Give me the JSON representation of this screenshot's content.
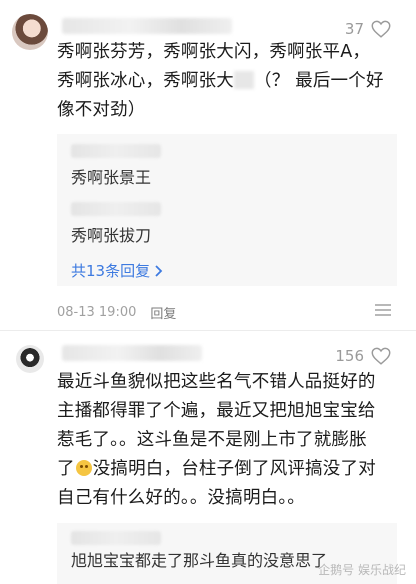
{
  "comments": [
    {
      "likes": "37",
      "text_lines": [
        "秀啊张芬芳，秀啊张大闪，秀啊张平A，",
        "秀啊张冰心，秀啊张大",
        "（？ 最后一个好",
        "像不对劲）"
      ],
      "replies": [
        {
          "text": "秀啊张景王"
        },
        {
          "text": "秀啊张拔刀"
        }
      ],
      "more_replies": "共13条回复",
      "time": "08-13 19:00",
      "reply_label": "回复"
    },
    {
      "likes": "156",
      "text_lines": [
        "最近斗鱼貌似把这些名气不错人品挺好的",
        "主播都得罪了个遍，最近又把旭旭宝宝给",
        "惹毛了。。这斗鱼是不是刚上市了就膨胀",
        "了",
        "没搞明白，台柱子倒了风评搞没了对",
        "自己有什么好的。。没搞明白。。"
      ],
      "replies": [
        {
          "text": "旭旭宝宝都走了那斗鱼真的没意思了"
        }
      ]
    }
  ],
  "watermark": "企鹅号 娱乐战纪"
}
